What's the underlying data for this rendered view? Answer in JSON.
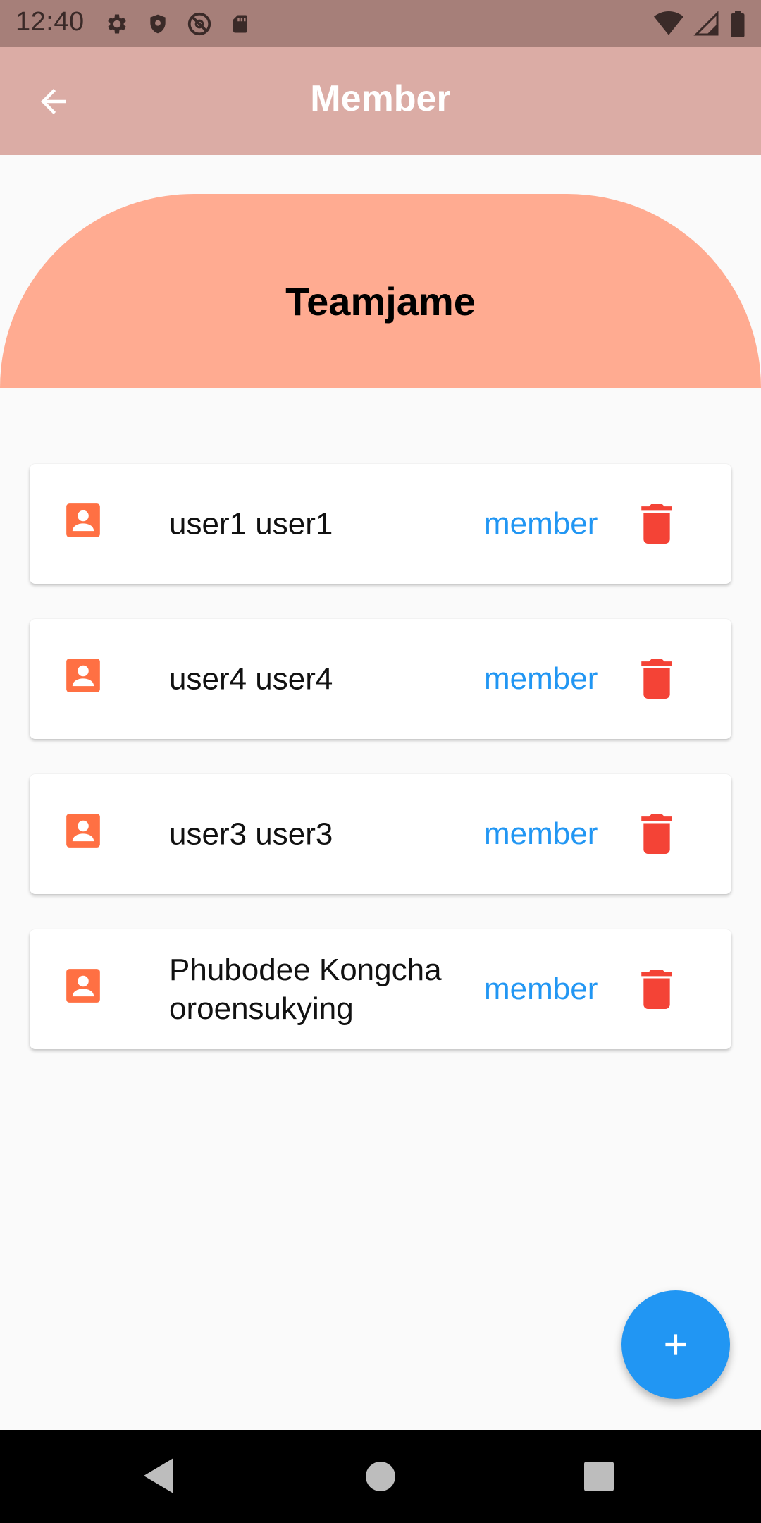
{
  "status_bar": {
    "time": "12:40",
    "icons_left": [
      "gear-icon",
      "shield-icon",
      "do-not-disturb-icon",
      "sd-card-icon"
    ],
    "icons_right": [
      "wifi-icon",
      "signal-icon",
      "battery-icon"
    ]
  },
  "app_bar": {
    "title": "Member",
    "back_icon": "arrow-back-icon"
  },
  "team": {
    "name": "Teamjame"
  },
  "members": [
    {
      "name": "user1 user1",
      "role": "member"
    },
    {
      "name": "user4 user4",
      "role": "member"
    },
    {
      "name": "user3 user3",
      "role": "member"
    },
    {
      "name": "Phubodee Kongchaoroensukying",
      "role": "member"
    }
  ],
  "fab": {
    "icon": "plus-icon"
  },
  "colors": {
    "status_bar": "#a67f79",
    "app_bar": "#dbaca5",
    "header": "#ffab91",
    "avatar_icon": "#ff7043",
    "role_text": "#2196f3",
    "delete_icon": "#f44336",
    "fab": "#2196f3"
  },
  "nav_bar": {
    "icons": [
      "nav-back-icon",
      "nav-home-icon",
      "nav-recents-icon"
    ]
  }
}
